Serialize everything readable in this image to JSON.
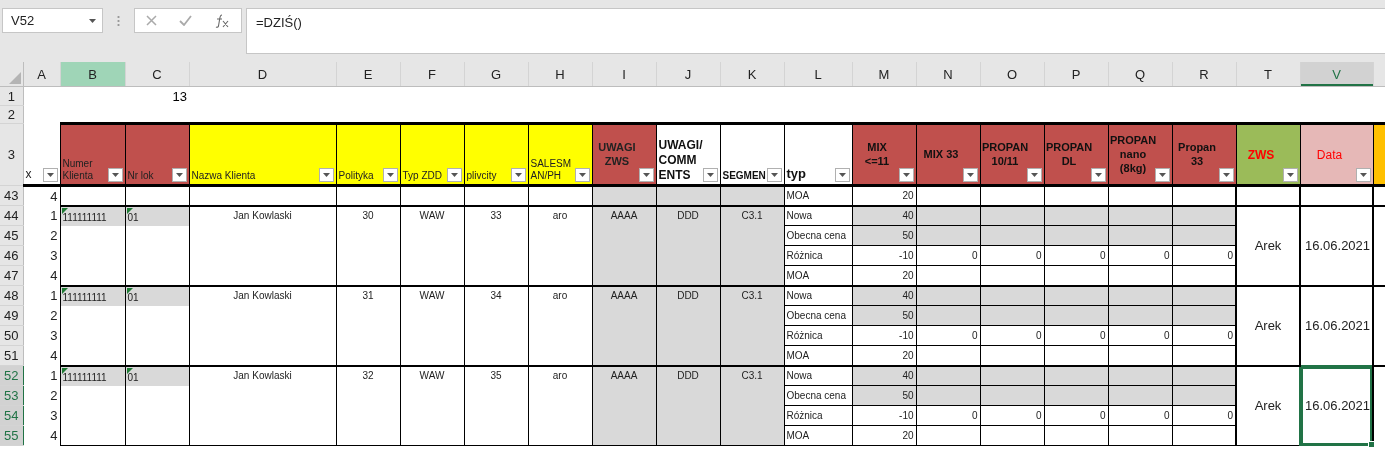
{
  "formula_bar": {
    "name_box": "V52",
    "formula": "=DZIŚ()"
  },
  "columns": [
    {
      "label": "A",
      "selected": false,
      "highlighted": false
    },
    {
      "label": "B",
      "selected": false,
      "highlighted": true
    },
    {
      "label": "C",
      "selected": false,
      "highlighted": false
    },
    {
      "label": "D",
      "selected": false,
      "highlighted": false
    },
    {
      "label": "E",
      "selected": false,
      "highlighted": false
    },
    {
      "label": "F",
      "selected": false,
      "highlighted": false
    },
    {
      "label": "G",
      "selected": false,
      "highlighted": false
    },
    {
      "label": "H",
      "selected": false,
      "highlighted": false
    },
    {
      "label": "I",
      "selected": false,
      "highlighted": false
    },
    {
      "label": "J",
      "selected": false,
      "highlighted": false
    },
    {
      "label": "K",
      "selected": false,
      "highlighted": false
    },
    {
      "label": "L",
      "selected": false,
      "highlighted": false
    },
    {
      "label": "M",
      "selected": false,
      "highlighted": false
    },
    {
      "label": "N",
      "selected": false,
      "highlighted": false
    },
    {
      "label": "O",
      "selected": false,
      "highlighted": false
    },
    {
      "label": "P",
      "selected": false,
      "highlighted": false
    },
    {
      "label": "Q",
      "selected": false,
      "highlighted": false
    },
    {
      "label": "R",
      "selected": false,
      "highlighted": false
    },
    {
      "label": "T",
      "selected": false,
      "highlighted": false
    },
    {
      "label": "V",
      "selected": true,
      "highlighted": false
    }
  ],
  "top_rows": [
    {
      "row": "1",
      "value": "13"
    },
    {
      "row": "2"
    }
  ],
  "header_row": {
    "row": "3",
    "cells": [
      {
        "label": "x",
        "kind": "plain"
      },
      {
        "label": "Numer Klienta",
        "kind": "key"
      },
      {
        "label": "Nr lok",
        "kind": "key"
      },
      {
        "label": "Nazwa Klienta",
        "kind": "info"
      },
      {
        "label": "Polityka",
        "kind": "info"
      },
      {
        "label": "Typ ZDD",
        "kind": "info"
      },
      {
        "label": "plivcity",
        "kind": "info"
      },
      {
        "label": "SALESMAN/PH",
        "kind": "info"
      },
      {
        "label": "UWAGI ZWS",
        "kind": "remark"
      },
      {
        "label": "UWAGI/COMMENTS",
        "kind": "comment"
      },
      {
        "label": "SEGMEN",
        "kind": "segment"
      },
      {
        "label": "typ",
        "kind": "type"
      },
      {
        "label": "MIX <=11",
        "kind": "product"
      },
      {
        "label": "MIX 33",
        "kind": "product"
      },
      {
        "label": "PROPAN 10/11",
        "kind": "product"
      },
      {
        "label": "PROPAN DL",
        "kind": "product"
      },
      {
        "label": "PROPAN nano (8kg)",
        "kind": "product"
      },
      {
        "label": "Propan 33",
        "kind": "product"
      },
      {
        "label": "ZWS",
        "kind": "owner"
      },
      {
        "label": "Data",
        "kind": "date"
      }
    ]
  },
  "lead_row": {
    "row": "43",
    "a": "4",
    "type": "MOA",
    "value": "20"
  },
  "groups": [
    {
      "rows": [
        {
          "row": "44",
          "a": "1",
          "selected": false
        },
        {
          "row": "45",
          "a": "2",
          "selected": false
        },
        {
          "row": "46",
          "a": "3",
          "selected": false
        },
        {
          "row": "47",
          "a": "4",
          "selected": false
        }
      ],
      "flagged": true,
      "client_no": "111111111",
      "lok": "01",
      "name": "Jan Kowlaski",
      "polityka": "30",
      "typ_zdd": "WAW",
      "plivcity": "33",
      "salesman": "aro",
      "uwagi_zws": "AAAA",
      "uwagi": "DDD",
      "segment": "C3.1",
      "lines": [
        {
          "label": "Nowa",
          "value": "40",
          "shaded": true
        },
        {
          "label": "Obecna cena",
          "value": "50",
          "shaded": true
        },
        {
          "label": "Różnica",
          "value": "-10",
          "shaded": false,
          "products": [
            "0",
            "0",
            "0",
            "0",
            "0"
          ]
        },
        {
          "label": "MOA",
          "value": "20",
          "shaded": false
        }
      ],
      "zws": "Arek",
      "date": "16.06.2021",
      "date_selected": false
    },
    {
      "rows": [
        {
          "row": "48",
          "a": "1",
          "selected": false
        },
        {
          "row": "49",
          "a": "2",
          "selected": false
        },
        {
          "row": "50",
          "a": "3",
          "selected": false
        },
        {
          "row": "51",
          "a": "4",
          "selected": false
        }
      ],
      "flagged": true,
      "client_no": "111111111",
      "lok": "01",
      "name": "Jan Kowlaski",
      "polityka": "31",
      "typ_zdd": "WAW",
      "plivcity": "34",
      "salesman": "aro",
      "uwagi_zws": "AAAA",
      "uwagi": "DDD",
      "segment": "C3.1",
      "lines": [
        {
          "label": "Nowa",
          "value": "40",
          "shaded": true
        },
        {
          "label": "Obecna cena",
          "value": "50",
          "shaded": true
        },
        {
          "label": "Różnica",
          "value": "-10",
          "shaded": false,
          "products": [
            "0",
            "0",
            "0",
            "0",
            "0"
          ]
        },
        {
          "label": "MOA",
          "value": "20",
          "shaded": false
        }
      ],
      "zws": "Arek",
      "date": "16.06.2021",
      "date_selected": false
    },
    {
      "rows": [
        {
          "row": "52",
          "a": "1",
          "selected": true
        },
        {
          "row": "53",
          "a": "2",
          "selected": true
        },
        {
          "row": "54",
          "a": "3",
          "selected": true
        },
        {
          "row": "55",
          "a": "4",
          "selected": true
        }
      ],
      "flagged": true,
      "client_no": "111111111",
      "lok": "01",
      "name": "Jan Kowlaski",
      "polityka": "32",
      "typ_zdd": "WAW",
      "plivcity": "35",
      "salesman": "aro",
      "uwagi_zws": "AAAA",
      "uwagi": "DDD",
      "segment": "C3.1",
      "lines": [
        {
          "label": "Nowa",
          "value": "40",
          "shaded": true
        },
        {
          "label": "Obecna cena",
          "value": "50",
          "shaded": true
        },
        {
          "label": "Różnica",
          "value": "-10",
          "shaded": false,
          "products": [
            "0",
            "0",
            "0",
            "0",
            "0"
          ]
        },
        {
          "label": "MOA",
          "value": "20",
          "shaded": false
        }
      ],
      "zws": "Arek",
      "date": "16.06.2021",
      "date_selected": true
    }
  ]
}
